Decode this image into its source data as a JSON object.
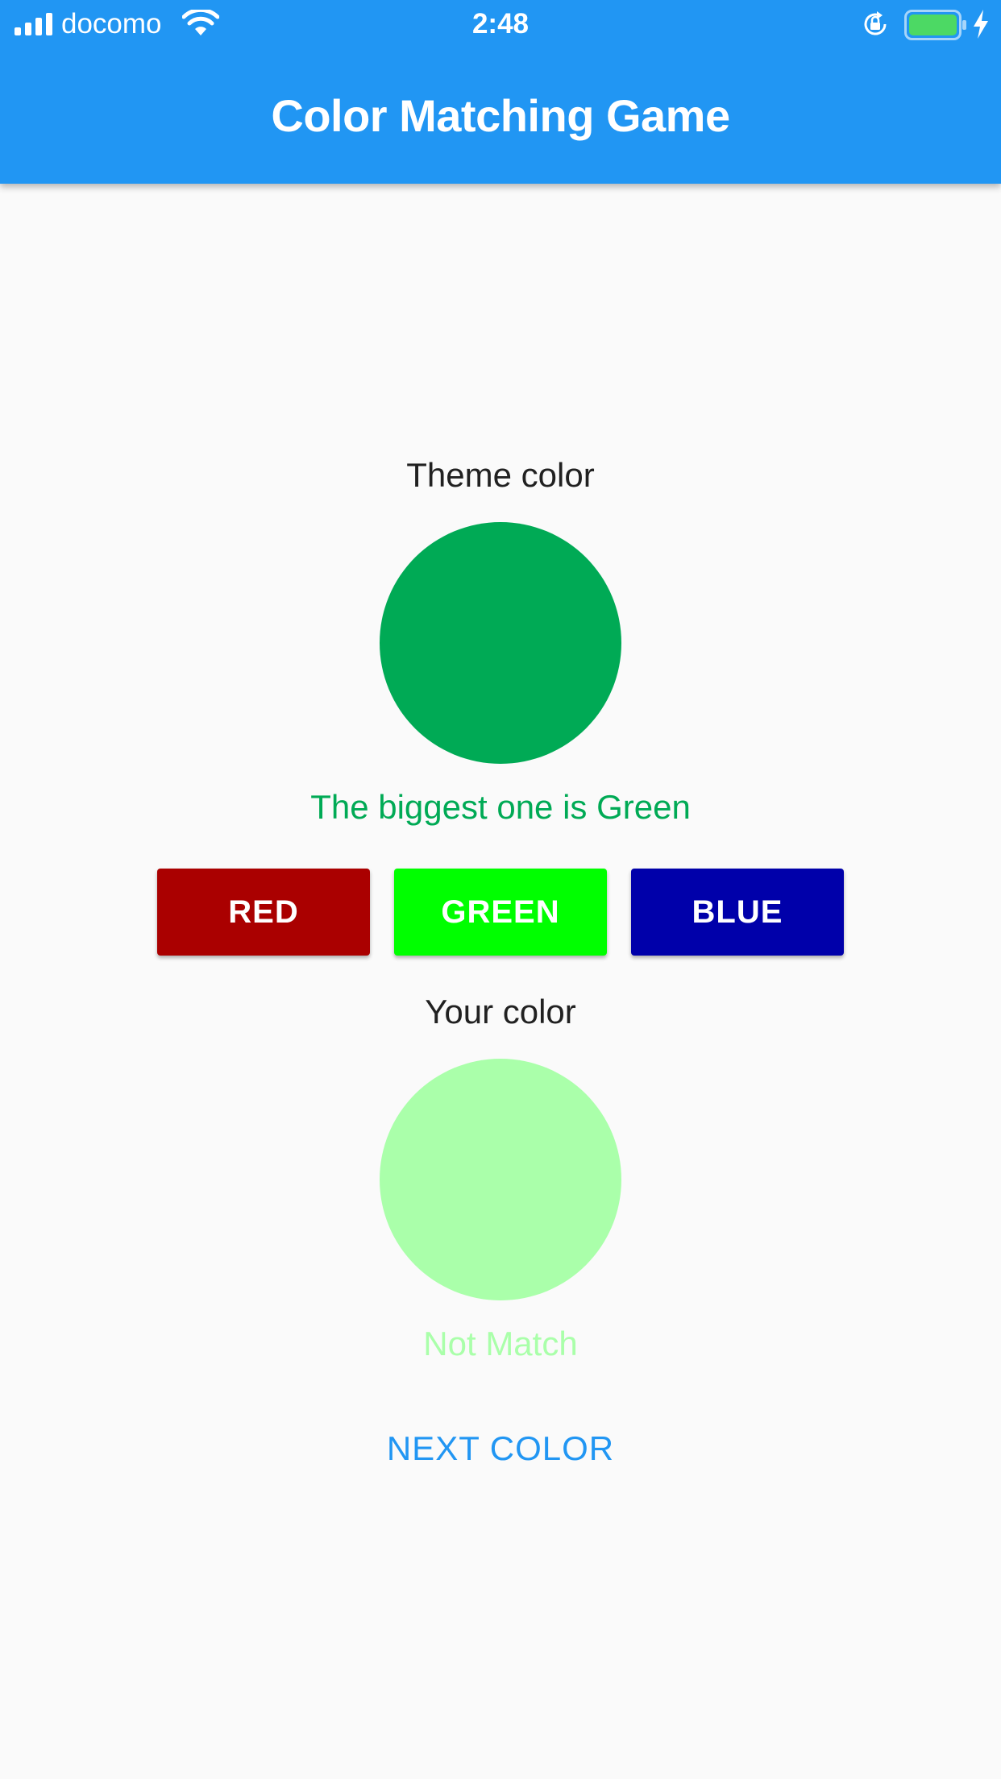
{
  "status_bar": {
    "carrier": "docomo",
    "time": "2:48",
    "signal_icon": "cellular-signal-icon",
    "wifi_icon": "wifi-icon",
    "rotation_lock_icon": "rotation-lock-icon",
    "battery_icon": "battery-icon",
    "charging_icon": "charging-bolt-icon"
  },
  "app_bar": {
    "title": "Color Matching Game",
    "color": "#2196f3"
  },
  "theme": {
    "label": "Theme color",
    "color": "#00aa55",
    "hint": "The biggest one is Green",
    "hint_color": "#00aa55"
  },
  "color_buttons": [
    {
      "label": "RED",
      "color": "#aa0000"
    },
    {
      "label": "GREEN",
      "color": "#00ff00"
    },
    {
      "label": "BLUE",
      "color": "#0000aa"
    }
  ],
  "player": {
    "label": "Your color",
    "color": "#aaffaa",
    "result": "Not Match",
    "result_color": "#aaffaa"
  },
  "next_button": {
    "label": "NEXT COLOR",
    "color": "#2196f3"
  }
}
